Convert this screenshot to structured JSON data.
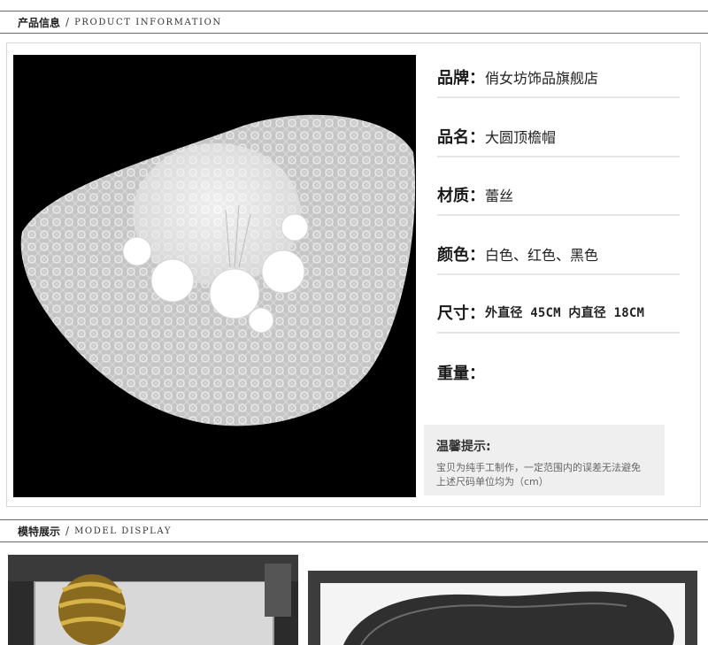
{
  "section1": {
    "title_cn": "产品信息",
    "slash": "/",
    "title_en": "PRODUCT INFORMATION"
  },
  "product": {
    "brand": {
      "label": "品牌：",
      "value": "俏女坊饰品旗舰店"
    },
    "name": {
      "label": "品名：",
      "value": "大圆顶檐帽"
    },
    "material": {
      "label": "材质：",
      "value": "蕾丝"
    },
    "color": {
      "label": "颜色：",
      "value": "白色、红色、黑色"
    },
    "size": {
      "label": "尺寸：",
      "value": "外直径 45CM  内直径 18CM"
    },
    "weight": {
      "label": "重量：",
      "value": ""
    }
  },
  "tip": {
    "title": "温馨提示:",
    "line1": "宝贝为纯手工制作，一定范围内的误差无法避免",
    "line2": "上述尺码单位均为（cm）"
  },
  "section2": {
    "title_cn": "模特展示",
    "slash": "/",
    "title_en": "MODEL DISPLAY"
  },
  "colors": {
    "border": "#6b6b6b",
    "divider": "#e6e6e6",
    "tip_bg": "#efefef",
    "photo_bg": "#000000"
  }
}
